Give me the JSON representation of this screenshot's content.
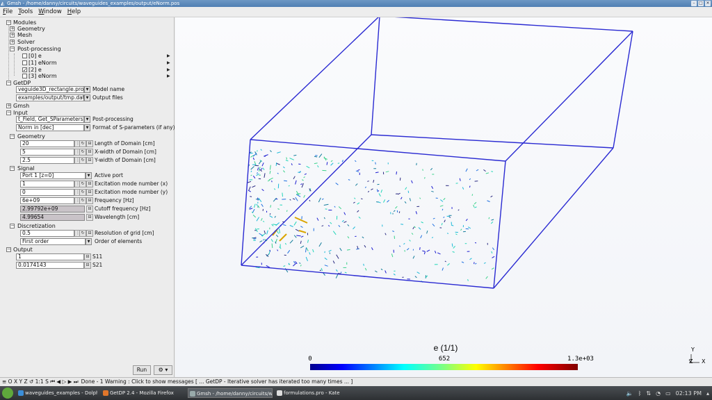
{
  "window": {
    "title": "Gmsh - /home/danny/circuits/waveguides_examples/output/eNorm.pos"
  },
  "menu": {
    "file": "File",
    "tools": "Tools",
    "window": "Window",
    "help": "Help"
  },
  "tree": {
    "modules": "Modules",
    "geometry": "Geometry",
    "mesh": "Mesh",
    "solver": "Solver",
    "postprocessing": "Post-processing",
    "views": [
      {
        "label": "[0] e",
        "checked": false
      },
      {
        "label": "[1] eNorm",
        "checked": false
      },
      {
        "label": "[2] e",
        "checked": true
      },
      {
        "label": "[3] eNorm",
        "checked": false
      }
    ],
    "getdp": "GetDP",
    "model_name_value": "veguide3D_rectangle.pro",
    "model_name_label": "Model name",
    "output_files_value": "examples/output/tmp.dat",
    "output_files_label": "Output files",
    "gmsh": "Gmsh",
    "input": "Input",
    "postproc_value": "t_Field, Get_SParameters",
    "postproc_label": "Post-processing",
    "format_value": "Norm in [dec]",
    "format_label": "Format of S-parameters (if any)",
    "geometry_group": "Geometry",
    "length_value": "20",
    "length_label": "Length of Domain [cm]",
    "xwidth_value": "5",
    "xwidth_label": "X-width of Domain [cm]",
    "ywidth_value": "2.5",
    "ywidth_label": "Y-width of Domain [cm]",
    "signal_group": "Signal",
    "port_value": "Port 1 [z=0]",
    "port_label": "Active port",
    "modex_value": "1",
    "modex_label": "Excitation mode number (x)",
    "modey_value": "0",
    "modey_label": "Excitation mode number (y)",
    "freq_value": "6e+09",
    "freq_label": "Frequency [Hz]",
    "cutoff_value": "2.99792e+09",
    "cutoff_label": "Cutoff frequency [Hz]",
    "wavelength_value": "4.99654",
    "wavelength_label": "Wavelength [cm]",
    "disc_group": "Discretization",
    "res_value": "0.5",
    "res_label": "Resolution of grid [cm]",
    "order_value": "First order",
    "order_label": "Order of elements",
    "output_group": "Output",
    "s11_value": "1",
    "s11_label": "S11",
    "s21_value": "0.0174143",
    "s21_label": "S21"
  },
  "buttons": {
    "run": "Run",
    "gear": "⚙"
  },
  "colorbar": {
    "title": "e (1/1)",
    "min": "0",
    "mid": "652",
    "max": "1.3e+03"
  },
  "axes": {
    "y": "Y",
    "z": "Z",
    "x": "X"
  },
  "status": {
    "toolbar": "≡ O X Y Z ↺ 1:1 S ⏮ ◀ ▷ ▶ ⏭",
    "message": "Done  -  1 Warning : Click to show messages [ ... GetDP - Iterative solver has iterated too many times ... ]"
  },
  "taskbar": {
    "tasks": [
      "waveguides_examples - Dolph",
      "GetDP 2.4 - Mozilla Firefox",
      "Gmsh - /home/danny/circuits/w",
      "formulations.pro - Kate"
    ],
    "clock": "02:13 PM"
  },
  "colors": {
    "box_edge": "#2a2ad2",
    "accent": "#4f7fb3"
  }
}
